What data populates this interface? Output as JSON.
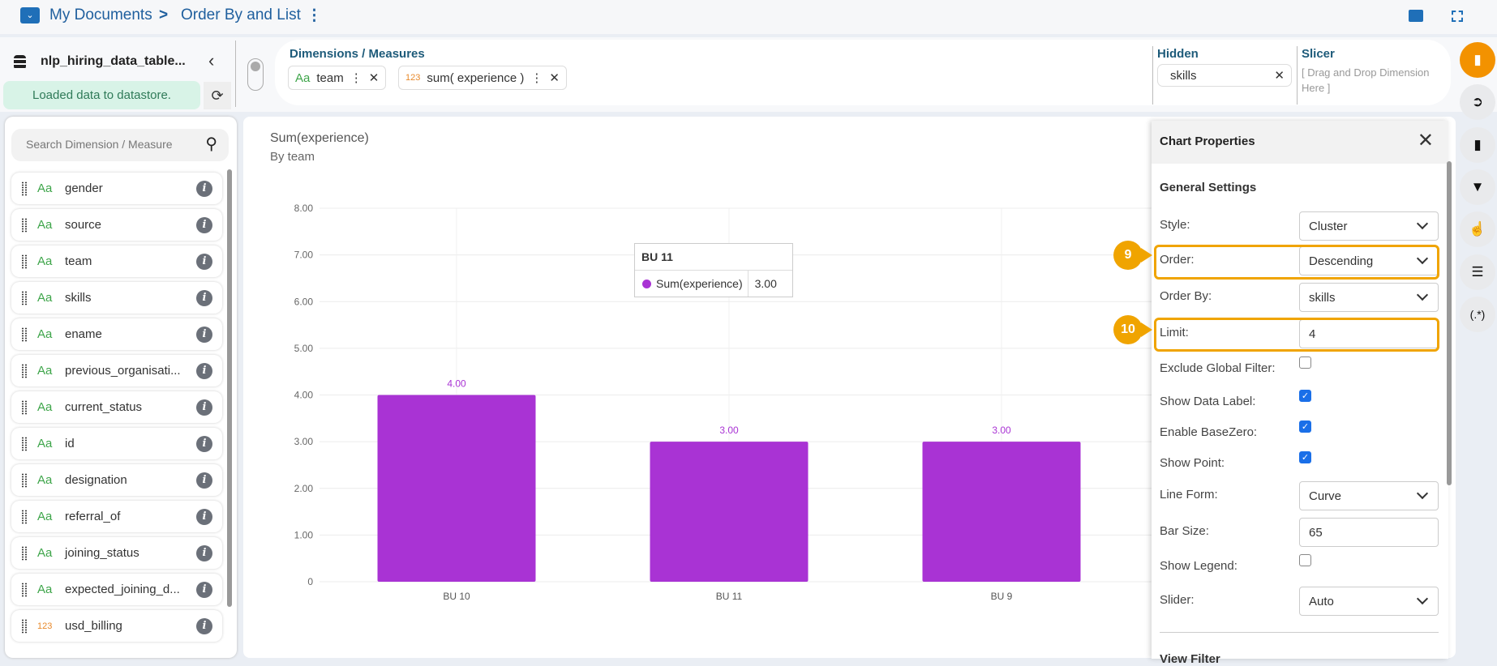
{
  "topbar": {
    "root": "My Documents",
    "separator": ">",
    "title": "Order By and List"
  },
  "datasource": {
    "name": "nlp_hiring_data_table...",
    "status": "Loaded data to datastore."
  },
  "shelf": {
    "dims_title": "Dimensions / Measures",
    "chips": [
      {
        "type": "Aa",
        "label": "team"
      },
      {
        "type": "123",
        "label": "sum( experience )"
      }
    ],
    "hidden_title": "Hidden",
    "hidden_value": "skills",
    "slicer_title": "Slicer",
    "slicer_placeholder": "[ Drag and Drop Dimension Here ]"
  },
  "fields": {
    "search_placeholder": "Search Dimension / Measure",
    "items": [
      {
        "type": "Aa",
        "name": "gender"
      },
      {
        "type": "Aa",
        "name": "source"
      },
      {
        "type": "Aa",
        "name": "team"
      },
      {
        "type": "Aa",
        "name": "skills"
      },
      {
        "type": "Aa",
        "name": "ename"
      },
      {
        "type": "Aa",
        "name": "previous_organisati..."
      },
      {
        "type": "Aa",
        "name": "current_status"
      },
      {
        "type": "Aa",
        "name": "id"
      },
      {
        "type": "Aa",
        "name": "designation"
      },
      {
        "type": "Aa",
        "name": "referral_of"
      },
      {
        "type": "Aa",
        "name": "joining_status"
      },
      {
        "type": "Aa",
        "name": "expected_joining_d..."
      },
      {
        "type": "123",
        "name": "usd_billing"
      }
    ]
  },
  "chart_data": {
    "type": "bar",
    "title": "Sum(experience)",
    "subtitle": "By team",
    "categories": [
      "BU 10",
      "BU 11",
      "BU 9"
    ],
    "series": [
      {
        "name": "Sum(experience)",
        "values": [
          4,
          3,
          3
        ]
      }
    ],
    "data_labels": [
      "4.00",
      "3.00",
      "3.00"
    ],
    "ylim": [
      0,
      8
    ],
    "yticks": [
      "0",
      "1.00",
      "2.00",
      "3.00",
      "4.00",
      "5.00",
      "6.00",
      "7.00",
      "8.00"
    ],
    "grid": true,
    "color": "#a933d4",
    "tooltip": {
      "title": "BU 11",
      "series": "Sum(experience)",
      "value": "3.00"
    }
  },
  "props": {
    "title": "Chart Properties",
    "section": "General Settings",
    "next_section": "View Filter",
    "rows": [
      {
        "label": "Style:",
        "kind": "select",
        "value": "Cluster"
      },
      {
        "label": "Order:",
        "kind": "select",
        "value": "Descending"
      },
      {
        "label": "Order By:",
        "kind": "select",
        "value": "skills"
      },
      {
        "label": "Limit:",
        "kind": "input",
        "value": "4"
      },
      {
        "label": "Exclude Global Filter:",
        "kind": "check",
        "checked": false
      },
      {
        "label": "Show Data Label:",
        "kind": "check",
        "checked": true
      },
      {
        "label": "Enable BaseZero:",
        "kind": "check",
        "checked": true
      },
      {
        "label": "Show Point:",
        "kind": "check",
        "checked": true
      },
      {
        "label": "Line Form:",
        "kind": "select",
        "value": "Curve"
      },
      {
        "label": "Bar Size:",
        "kind": "input",
        "value": "65"
      },
      {
        "label": "Show Legend:",
        "kind": "check",
        "checked": false
      },
      {
        "label": "Slider:",
        "kind": "select",
        "value": "Auto"
      }
    ]
  },
  "callouts": [
    "9",
    "10"
  ],
  "rail": {
    "regex_label": "(.*)"
  }
}
